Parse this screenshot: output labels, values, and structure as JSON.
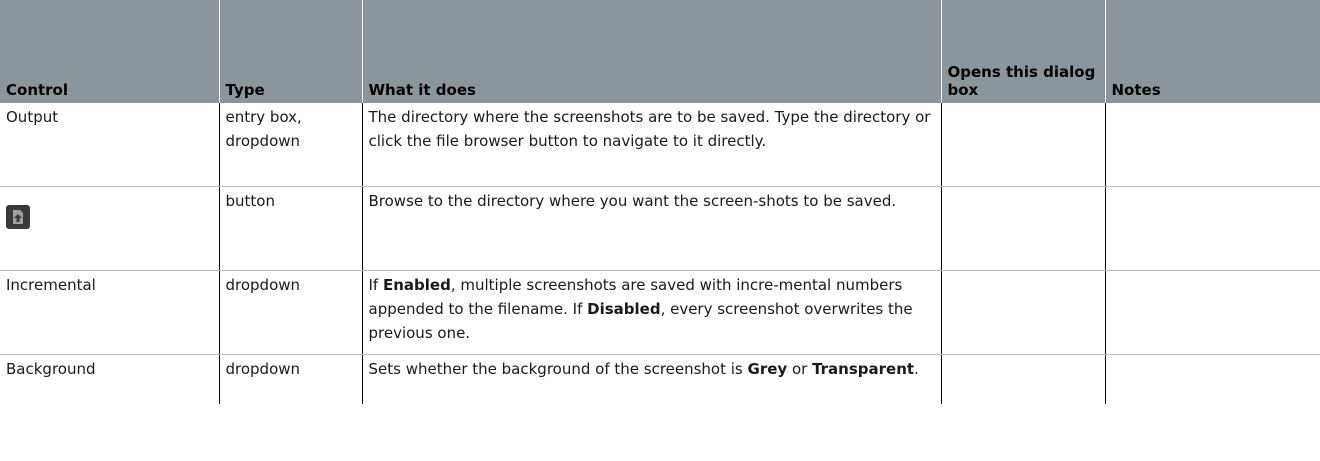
{
  "headers": {
    "control": "Control",
    "type": "Type",
    "what": "What it does",
    "opens": "Opens this dialog box",
    "notes": "Notes"
  },
  "rows": [
    {
      "control": "Output",
      "type": "entry box, dropdown",
      "what": "The directory where the screenshots are to be saved. Type the directory or click the file browser button to navigate to it directly.",
      "opens": "",
      "notes": ""
    },
    {
      "control_icon": "file-browser-icon",
      "type": "button",
      "what": "Browse to the directory where you want the screen-shots to be saved.",
      "opens": "",
      "notes": ""
    },
    {
      "control": "Incremental",
      "type": "dropdown",
      "what_parts": [
        "If ",
        "Enabled",
        ", multiple screenshots are saved with incre-mental numbers appended to the filename. If ",
        "Disabled",
        ", every screenshot overwrites the previous one."
      ],
      "opens": "",
      "notes": ""
    },
    {
      "control": "Background",
      "type": "dropdown",
      "what_parts": [
        "Sets whether the background of the screenshot is ",
        "Grey",
        " or ",
        "Transparent",
        "."
      ],
      "opens": "",
      "notes": ""
    }
  ],
  "colors": {
    "header_bg": "#8a969c",
    "icon_bg": "#3a3a3a",
    "icon_fg": "#9aa0a4"
  }
}
